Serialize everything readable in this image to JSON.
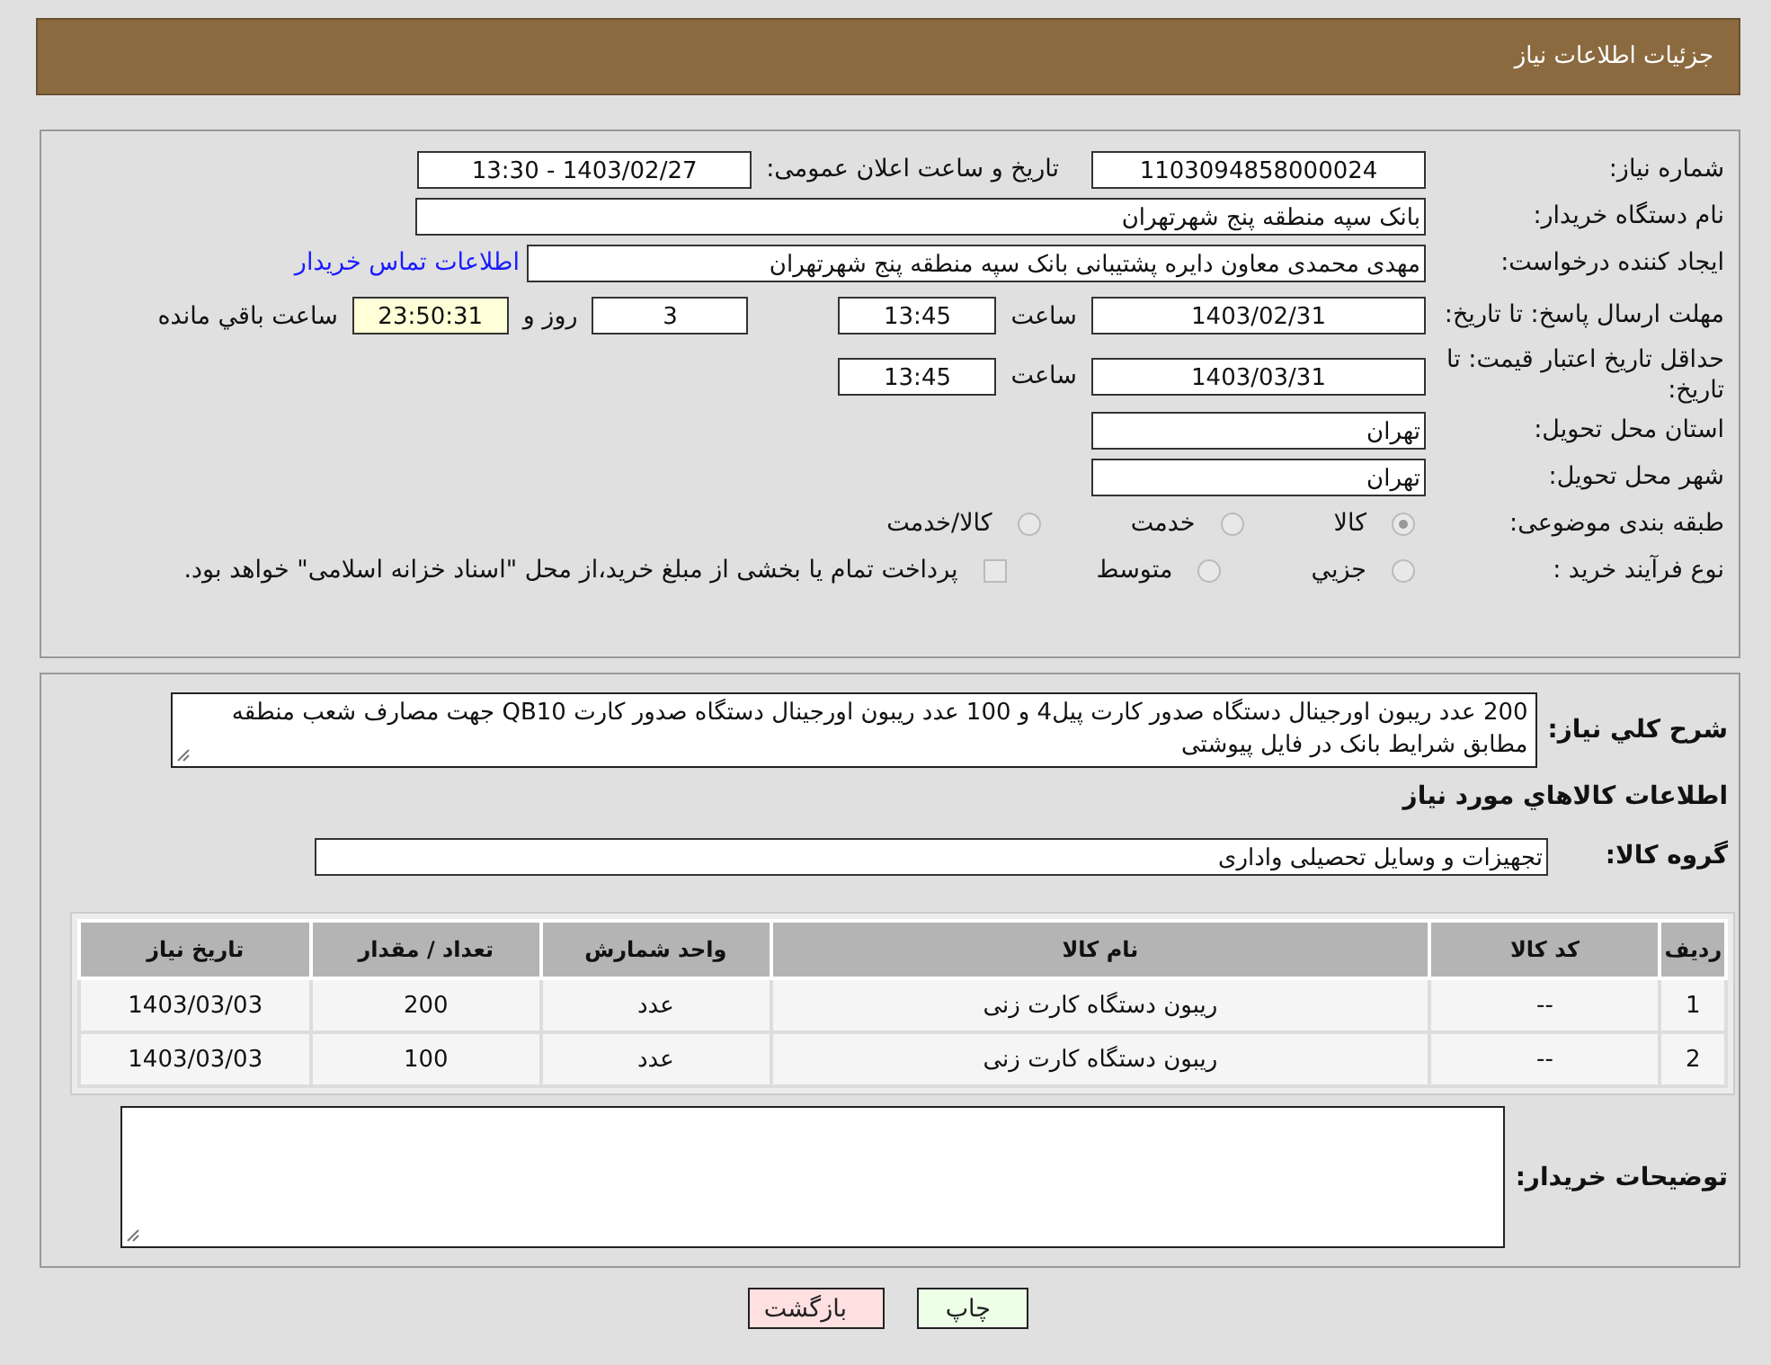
{
  "header": {
    "title": "جزئیات اطلاعات نیاز"
  },
  "need_number": {
    "label": "شماره نیاز:",
    "value": "1103094858000024"
  },
  "announce": {
    "label": "تاریخ و ساعت اعلان عمومی:",
    "value": "1403/02/27 - 13:30"
  },
  "buyer": {
    "label": "نام دستگاه خریدار:",
    "value": "بانک سپه منطقه پنج شهرتهران"
  },
  "requester": {
    "label": "ایجاد کننده درخواست:",
    "value": "مهدی محمدی معاون دایره پشتیبانی بانک سپه منطقه پنج شهرتهران",
    "link": "اطلاعات تماس خریدار"
  },
  "reply_deadline": {
    "label": "مهلت ارسال پاسخ: تا تاریخ:",
    "date": "1403/02/31",
    "time_label": "ساعت",
    "time": "13:45",
    "days": "3",
    "days_label": "روز و",
    "remaining": "23:50:31",
    "remaining_label": "ساعت باقي مانده"
  },
  "price_validity": {
    "label": "حداقل تاریخ اعتبار قیمت: تا تاریخ:",
    "date": "1403/03/31",
    "time_label": "ساعت",
    "time": "13:45"
  },
  "province": {
    "label": "استان محل تحویل:",
    "value": "تهران"
  },
  "city": {
    "label": "شهر محل تحویل:",
    "value": "تهران"
  },
  "category": {
    "label": "طبقه بندی موضوعی:",
    "options": [
      {
        "label": "کالا",
        "selected": true
      },
      {
        "label": "خدمت",
        "selected": false
      },
      {
        "label": "کالا/خدمت",
        "selected": false
      }
    ]
  },
  "purchase_type": {
    "label": "نوع فرآیند خرید :",
    "options": [
      {
        "kind": "radio",
        "label": "جزيي",
        "selected": false
      },
      {
        "kind": "radio",
        "label": "متوسط",
        "selected": false
      },
      {
        "kind": "checkbox",
        "label": "پرداخت تمام یا بخشی از مبلغ خرید،از محل \"اسناد خزانه اسلامی\" خواهد بود.",
        "checked": false
      }
    ]
  },
  "description": {
    "label": "شرح كلي نياز:",
    "value": "200 عدد ریبون اورجینال دستگاه صدور کارت پیل4 و 100 عدد ریبون اورجینال دستگاه صدور کارت QB10 جهت مصارف شعب منطقه مطابق شرایط بانک در فایل پیوشتی"
  },
  "goods_heading": "اطلاعات كالاهاي مورد نياز",
  "goods_group": {
    "label": "گروه کالا:",
    "value": "تجهیزات و وسایل تحصیلی واداری"
  },
  "table": {
    "columns": [
      "ردیف",
      "کد کالا",
      "نام کالا",
      "واحد شمارش",
      "تعداد / مقدار",
      "تاریخ نیاز"
    ],
    "rows": [
      [
        "1",
        "--",
        "ریبون دستگاه کارت زنی",
        "عدد",
        "200",
        "1403/03/03"
      ],
      [
        "2",
        "--",
        "ریبون دستگاه کارت زنی",
        "عدد",
        "100",
        "1403/03/03"
      ]
    ]
  },
  "buyer_notes": {
    "label": "توضیحات خریدار:"
  },
  "buttons": [
    {
      "kind": "print",
      "label": "چاپ"
    },
    {
      "kind": "back",
      "label": "بازگشت"
    }
  ]
}
